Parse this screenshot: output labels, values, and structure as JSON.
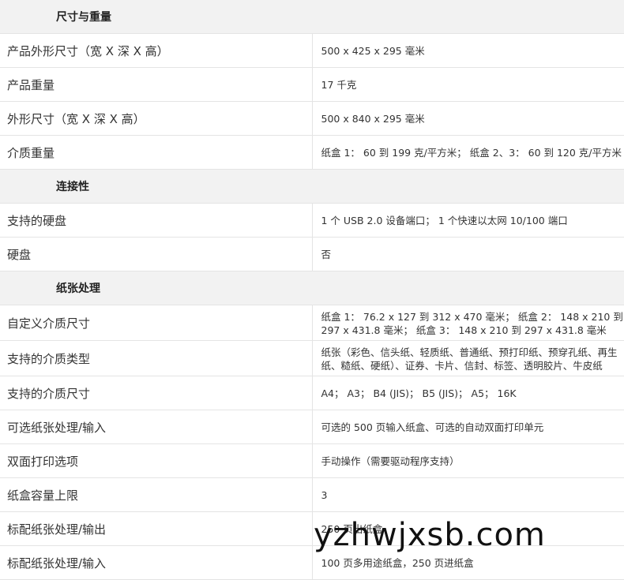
{
  "sections": [
    {
      "title": "尺寸与重量",
      "rows": [
        {
          "label": "产品外形尺寸（宽 X 深 X 高）",
          "value": "500 x 425 x 295 毫米"
        },
        {
          "label": "产品重量",
          "value": "17 千克"
        },
        {
          "label": "外形尺寸（宽 X 深 X 高）",
          "value": "500 x 840 x 295 毫米"
        },
        {
          "label": "介质重量",
          "value": "纸盒 1： 60 到 199 克/平方米； 纸盒 2、3： 60 到 120 克/平方米"
        }
      ]
    },
    {
      "title": "连接性",
      "rows": [
        {
          "label": "支持的硬盘",
          "value": "1 个 USB 2.0 设备端口； 1 个快速以太网 10/100 端口"
        },
        {
          "label": "硬盘",
          "value": "否"
        }
      ]
    },
    {
      "title": "纸张处理",
      "rows": [
        {
          "label": "自定义介质尺寸",
          "value": "纸盒 1： 76.2 x 127 到 312 x 470 毫米； 纸盒 2： 148 x 210 到 297 x 431.8 毫米； 纸盒 3： 148 x 210 到 297 x 431.8 毫米"
        },
        {
          "label": "支持的介质类型",
          "value": "纸张（彩色、信头纸、轻质纸、普通纸、预打印纸、预穿孔纸、再生纸、糙纸、硬纸）、证券、卡片、信封、标签、透明胶片、牛皮纸"
        },
        {
          "label": "支持的介质尺寸",
          "value": "A4； A3； B4 (JIS)； B5 (JIS)； A5； 16K"
        },
        {
          "label": "可选纸张处理/输入",
          "value": "可选的 500 页输入纸盒、可选的自动双面打印单元"
        },
        {
          "label": "双面打印选项",
          "value": "手动操作（需要驱动程序支持）"
        },
        {
          "label": "纸盒容量上限",
          "value": "3"
        },
        {
          "label": "标配纸张处理/输出",
          "value": "250 页出纸盒"
        },
        {
          "label": "标配纸张处理/输入",
          "value": "100 页多用途纸盒，250 页进纸盒"
        }
      ]
    }
  ],
  "watermark": "yzhwjxsb.com"
}
